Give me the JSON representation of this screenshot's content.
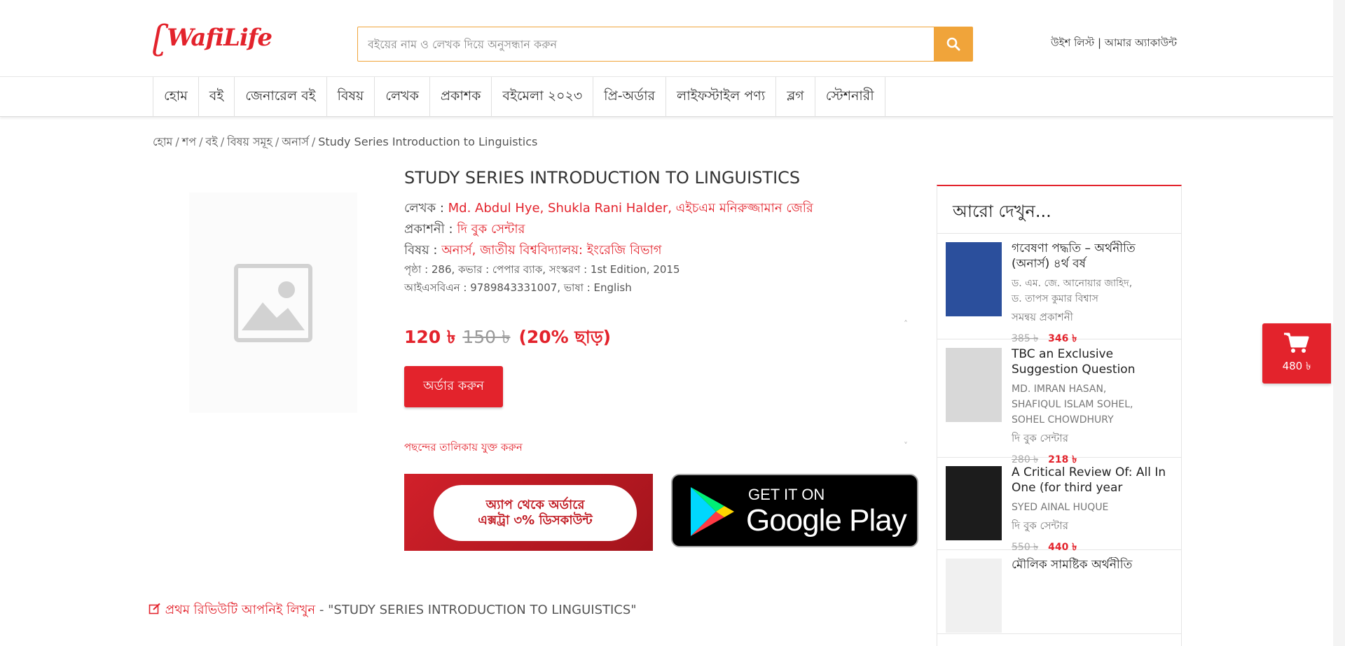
{
  "header": {
    "logo_text": "WafiLife",
    "search_placeholder": "বইয়ের নাম ও লেখক দিয়ে অনুসন্ধান করুন",
    "wishlist_label": "উইশ লিস্ট",
    "link_divider": "|",
    "account_label": "আমার অ্যাকাউন্ট"
  },
  "nav": {
    "items": [
      "হোম",
      "বই",
      "জেনারেল বই",
      "বিষয়",
      "লেখক",
      "প্রকাশক",
      "বইমেলা ২০২৩",
      "প্রি-অর্ডার",
      "লাইফস্টাইল পণ্য",
      "ব্লগ",
      "স্টেশনারী"
    ]
  },
  "breadcrumb": {
    "items": [
      "হোম",
      "শপ",
      "বই",
      "বিষয় সমূহ",
      "অনার্স"
    ],
    "current": "Study Series Introduction to Linguistics",
    "separator": "/"
  },
  "product": {
    "title": "STUDY SERIES INTRODUCTION TO LINGUISTICS",
    "author_label": "লেখক :",
    "authors": "Md. Abdul Hye, Shukla Rani Halder, এইচএম মনিরুজ্জামান জেরি",
    "publisher_label": "প্রকাশনী :",
    "publisher": "দি বুক সেন্টার",
    "subject_label": "বিষয় :",
    "subjects": "অনার্স, জাতীয় বিশ্ববিদ্যালয়: ইংরেজি বিভাগ",
    "specs_line": "পৃষ্ঠা : 286, কভার : পেপার ব্যাক, সংস্করণ : 1st Edition, 2015",
    "isbn_line": "আইএসবিএন : 9789843331007, ভাষা : English",
    "price": "120 ৳",
    "old_price": "150 ৳",
    "discount": "(20% ছাড়)",
    "order_button": "অর্ডার করুন",
    "wishlist_link": "পছন্দের তালিকায় যুক্ত করুন"
  },
  "app_banner": {
    "line1": "অ্যাপ থেকে অর্ডারে",
    "line2": "এক্সট্রা ৩% ডিসকাউন্ট"
  },
  "play_badge": {
    "get_it_on": "GET IT ON",
    "store_name": "Google Play"
  },
  "review": {
    "prompt": "প্রথম রিভিউটি আপনিই লিখুন",
    "dash": " - ",
    "product_quote": "\"STUDY SERIES INTRODUCTION TO LINGUISTICS\""
  },
  "sidebar": {
    "title": "আরো দেখুন...",
    "items": [
      {
        "name": "গবেষণা পদ্ধতি – অর্থনীতি (অনার্স) ৪র্থ বর্ষ",
        "authors": [
          "ড. এম. জে. আনোয়ার জাহিদ,",
          "ড. তাপস কুমার বিশ্বাস"
        ],
        "publisher": "সমন্বয় প্রকাশনী",
        "old_price": "385 ৳",
        "price": "346 ৳",
        "cover_color": "#2b4f9c"
      },
      {
        "name": "TBC an Exclusive Suggestion Question Bank...",
        "authors": [
          "MD. IMRAN HASAN,",
          "SHAFIQUL ISLAM SOHEL,",
          "SOHEL CHOWDHURY"
        ],
        "publisher": "দি বুক সেন্টার",
        "old_price": "280 ৳",
        "price": "218 ৳",
        "cover_color": "#d8d8d8"
      },
      {
        "name": "A Critical Review Of: All In One (for third year english...",
        "authors": [
          "SYED AINAL HUQUE"
        ],
        "publisher": "দি বুক সেন্টার",
        "old_price": "550 ৳",
        "price": "440 ৳",
        "cover_color": "#1c1c1c"
      },
      {
        "name": "মৌলিক সামষ্টিক অর্থনীতি",
        "authors": [],
        "publisher": "",
        "old_price": "",
        "price": "",
        "cover_color": "#f0f0f0"
      }
    ]
  },
  "cart": {
    "total": "480 ৳"
  },
  "colors": {
    "brand_red": "#e3232c",
    "search_orange": "#f0a43a"
  }
}
